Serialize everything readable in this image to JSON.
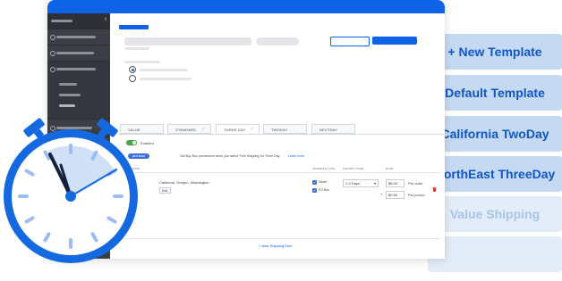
{
  "templates": [
    {
      "label": "+ New Template",
      "style": "active"
    },
    {
      "label": "Default Template",
      "style": "active"
    },
    {
      "label": "California TwoDay",
      "style": "active"
    },
    {
      "label": "NorthEast ThreeDay",
      "style": "active"
    },
    {
      "label": "Value Shipping",
      "style": "faint"
    }
  ],
  "tabs": [
    {
      "label": "VALUE"
    },
    {
      "label": "STANDARD"
    },
    {
      "label": "THREE DAY"
    },
    {
      "label": "TWODAY"
    },
    {
      "label": "NEXTDAY"
    }
  ],
  "panel": {
    "enabled_label": "Enabled",
    "buybox_badge": "BUY BOX BOOST",
    "buybox_text": "Get Buy Box prominence when you select 'Free Shipping' for Three Day.",
    "learn_more": "Learn more"
  },
  "table": {
    "headers": {
      "regions": "REGIONS",
      "address_type": "ADDRESS TYPE",
      "transit_time": "TRANSIT TIME",
      "rate": "RATE"
    },
    "row": {
      "regions": "California, Oregon, Washington",
      "edit": "Edit",
      "address_types": [
        "Street",
        "PO Box"
      ],
      "transit_time": "2-3 Days",
      "rate_per_order": "$5.00",
      "per_order_label": "Per order",
      "rate_per_pound": "$0.50",
      "per_pound_label": "Per pound",
      "plus": "+"
    },
    "new_rule": "+ New Shipping Rule"
  },
  "colors": {
    "primary": "#0e63e6",
    "sidebar": "#3b3f45",
    "template_bg": "#c5d9f3",
    "template_text": "#0f56c7",
    "clock_blue": "#1468e0"
  },
  "icons": [
    "alarm-clock-icon",
    "trash-icon",
    "chevron-down-icon",
    "check-icon"
  ]
}
